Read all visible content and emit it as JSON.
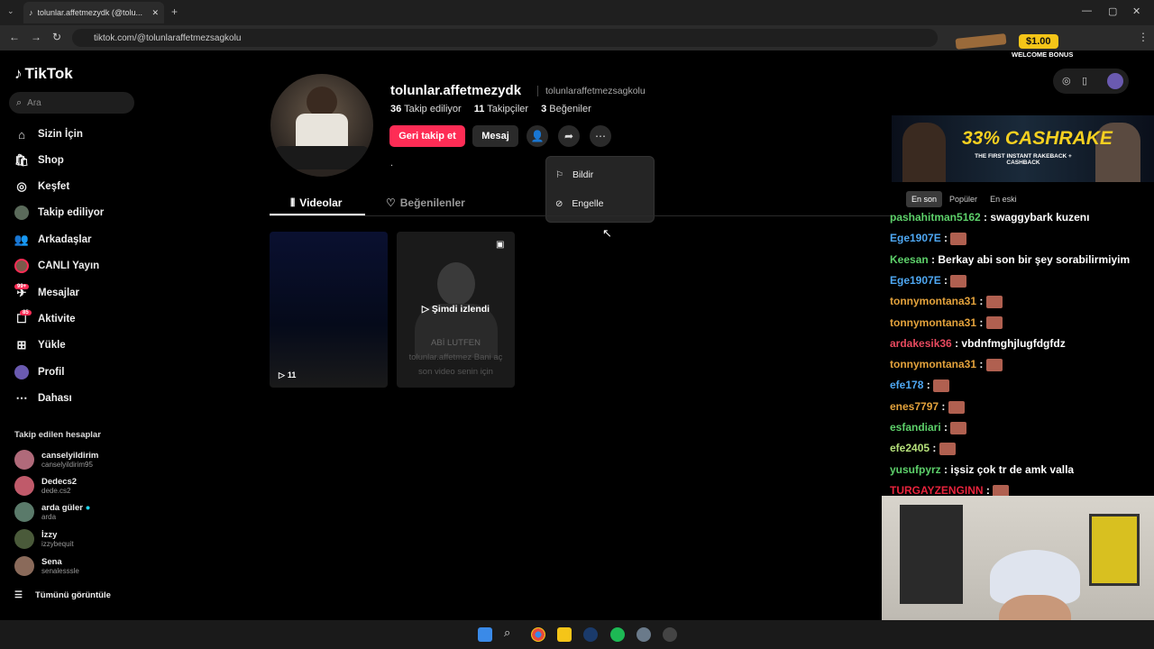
{
  "browser": {
    "tab_title": "tolunlar.affetmezydk (@tolu...",
    "url": "tiktok.com/@tolunlaraffetmezsagkolu"
  },
  "sidebar": {
    "logo": "TikTok",
    "search_placeholder": "Ara",
    "items": [
      {
        "label": "Sizin İçin",
        "icon": "home-icon"
      },
      {
        "label": "Shop",
        "icon": "shop-icon"
      },
      {
        "label": "Keşfet",
        "icon": "explore-icon"
      },
      {
        "label": "Takip ediliyor",
        "icon": "following-icon"
      },
      {
        "label": "Arkadaşlar",
        "icon": "friends-icon"
      },
      {
        "label": "CANLI Yayın",
        "icon": "live-icon"
      },
      {
        "label": "Mesajlar",
        "icon": "messages-icon",
        "badge": "99+"
      },
      {
        "label": "Aktivite",
        "icon": "activity-icon",
        "badge": "85"
      },
      {
        "label": "Yükle",
        "icon": "upload-icon"
      },
      {
        "label": "Profil",
        "icon": "profile-icon"
      },
      {
        "label": "Dahası",
        "icon": "more-icon"
      }
    ],
    "following_title": "Takip edilen hesaplar",
    "following": [
      {
        "name": "canselyildirim",
        "handle": "canselyildirim95"
      },
      {
        "name": "Dedecs2",
        "handle": "dede.cs2"
      },
      {
        "name": "arda güler",
        "handle": "arda"
      },
      {
        "name": "İzzy",
        "handle": "izzybequit"
      },
      {
        "name": "Sena",
        "handle": "senalesssle"
      }
    ],
    "see_all": "Tümünü görüntüle"
  },
  "profile": {
    "username": "tolunlar.affetmezydk",
    "handle": "tolunlaraffetmezsagkolu",
    "following_count": "36",
    "following_label": "Takip ediliyor",
    "followers_count": "11",
    "followers_label": "Takipçiler",
    "likes_count": "3",
    "likes_label": "Beğeniler",
    "bio": ".",
    "follow_back": "Geri takip et",
    "message": "Mesaj"
  },
  "menu": {
    "report": "Bildir",
    "block": "Engelle"
  },
  "tabs": {
    "videos": "Videolar",
    "liked": "Beğenilenler"
  },
  "videos": [
    {
      "views": "11"
    },
    {
      "overlay": "Şimdi izlendi",
      "caption1": "ABİ LUTFEN",
      "caption2": "tolunlar.affetmez Bani aç",
      "caption3": "son video senin için"
    }
  ],
  "ad": {
    "amount": "$1.00",
    "text": "WELCOME BONUS",
    "banner": "33% CASHRAKE",
    "banner_sub": "THE FIRST INSTANT RAKEBACK + CASHBACK"
  },
  "chat": {
    "tabs": [
      "En son",
      "Popüler",
      "En eski"
    ],
    "lines": [
      {
        "user": "pashahitman5162",
        "msg": "swaggybark kuzenı",
        "color": "#5dd06a"
      },
      {
        "user": "Ege1907E",
        "msg": "",
        "color": "#4ea7f2",
        "emote": true
      },
      {
        "user": "Keesan",
        "msg": "Berkay abi son bir şey sorabilirmiyim",
        "color": "#5dd06a"
      },
      {
        "user": "Ege1907E",
        "msg": "",
        "color": "#4ea7f2",
        "emote": true
      },
      {
        "user": "tonnymontana31",
        "msg": "",
        "color": "#e3a23c",
        "emote": true
      },
      {
        "user": "tonnymontana31",
        "msg": "",
        "color": "#e3a23c",
        "emote": true
      },
      {
        "user": "ardakesik36",
        "msg": "vbdnfmghjlugfdgfdz",
        "color": "#e84a5f"
      },
      {
        "user": "tonnymontana31",
        "msg": "",
        "color": "#e3a23c",
        "emote": true
      },
      {
        "user": "efe178",
        "msg": "",
        "color": "#4ea7f2",
        "emote": true
      },
      {
        "user": "enes7797",
        "msg": "",
        "color": "#e3a23c",
        "emote": true
      },
      {
        "user": "esfandiari",
        "msg": "",
        "color": "#5dd06a",
        "emote": true
      },
      {
        "user": "efe2405",
        "msg": "",
        "color": "#b5e07a",
        "emote": true
      },
      {
        "user": "yusufpyrz",
        "msg": "işsiz çok tr de amk valla",
        "color": "#5dd06a"
      },
      {
        "user": "TURGAYZENGINN",
        "msg": "",
        "color": "#e8233c",
        "emote": true
      }
    ]
  }
}
